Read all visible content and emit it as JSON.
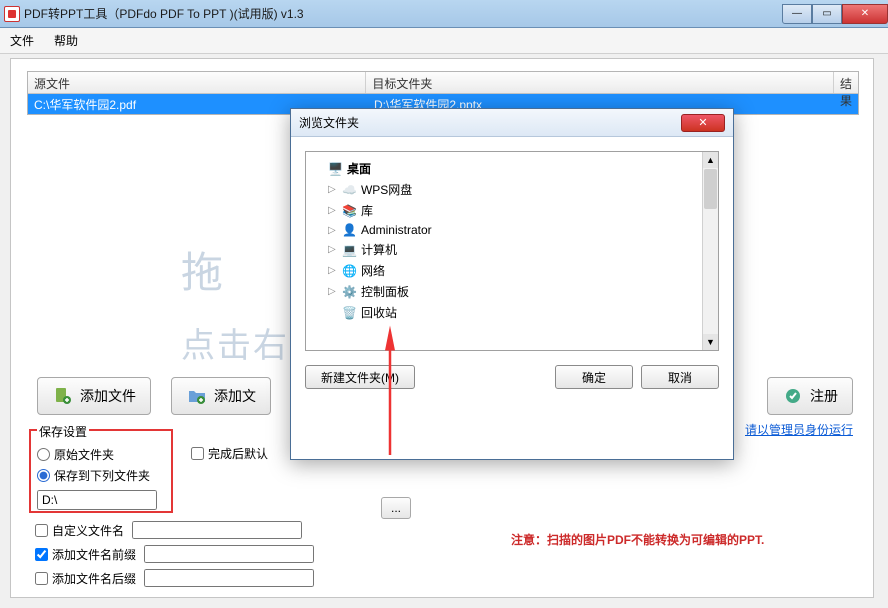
{
  "window": {
    "title": "PDF转PPT工具（PDFdo PDF To PPT )(试用版) v1.3"
  },
  "menu": {
    "file": "文件",
    "help": "帮助"
  },
  "table": {
    "headers": {
      "source": "源文件",
      "target": "目标文件夹",
      "result": "结果"
    },
    "row": {
      "source": "C:\\华军软件园2.pdf",
      "target": "D:\\华军软件园2.pptx",
      "result": ""
    }
  },
  "bgText": {
    "line1": "拖",
    "line2": "点击右"
  },
  "toolbar": {
    "addFile": "添加文件",
    "addFolder": "添加文",
    "register": "注册"
  },
  "runAsAdmin": "请以管理员身份运行",
  "saveSettings": {
    "legend": "保存设置",
    "optOriginal": "原始文件夹",
    "optCustom": "保存到下列文件夹",
    "path": "D:\\"
  },
  "afterConvert": {
    "label": "完成后默认"
  },
  "browseBtn": "...",
  "note": "注意：扫描的图片PDF不能转换为可编辑的PPT.",
  "options": {
    "customName": "自定义文件名",
    "prefix": "添加文件名前缀",
    "suffix": "添加文件名后缀"
  },
  "dialog": {
    "title": "浏览文件夹",
    "tree": {
      "desktop": "桌面",
      "wps": "WPS网盘",
      "lib": "库",
      "admin": "Administrator",
      "computer": "计算机",
      "network": "网络",
      "controlPanel": "控制面板",
      "recycle": "回收站"
    },
    "newFolder": "新建文件夹(M)",
    "ok": "确定",
    "cancel": "取消"
  }
}
